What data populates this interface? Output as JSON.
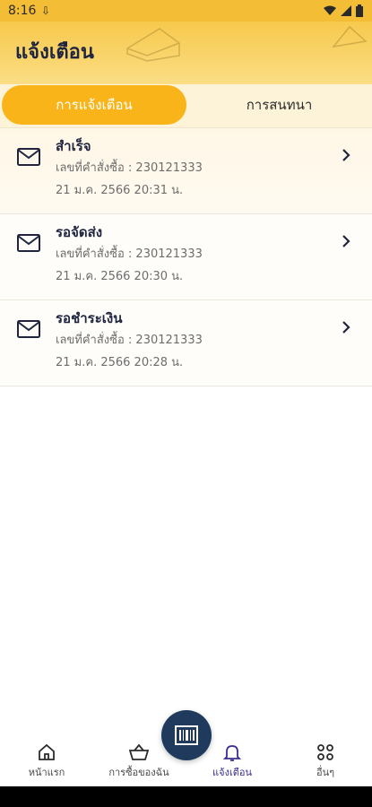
{
  "status_bar": {
    "time": "8:16"
  },
  "header": {
    "title": "แจ้งเตือน"
  },
  "tabs": [
    {
      "label": "การแจ้งเตือน",
      "active": true
    },
    {
      "label": "การสนทนา",
      "active": false
    }
  ],
  "notifications": [
    {
      "title": "สำเร็จ",
      "order": "เลขที่คำสั่งซื้อ : 230121333",
      "date": "21 ม.ค. 2566 20:31 น."
    },
    {
      "title": "รอจัดส่ง",
      "order": "เลขที่คำสั่งซื้อ : 230121333",
      "date": "21 ม.ค. 2566 20:30 น."
    },
    {
      "title": "รอชำระเงิน",
      "order": "เลขที่คำสั่งซื้อ : 230121333",
      "date": "21 ม.ค. 2566 20:28 น."
    }
  ],
  "bottom_nav": [
    {
      "label": "หน้าแรก",
      "icon": "home-icon"
    },
    {
      "label": "การซื้อของฉัน",
      "icon": "basket-icon"
    },
    {
      "label": "แจ้งเตือน",
      "icon": "bell-icon",
      "active": true
    },
    {
      "label": "อื่นๆ",
      "icon": "grid-icon"
    }
  ],
  "scan_button": {
    "icon": "barcode-icon"
  },
  "colors": {
    "accent": "#f8b418",
    "header": "#f7c94c",
    "primary_text": "#1f2540",
    "nav_active": "#3a2f8e",
    "scan_button": "#1f3a5c"
  }
}
